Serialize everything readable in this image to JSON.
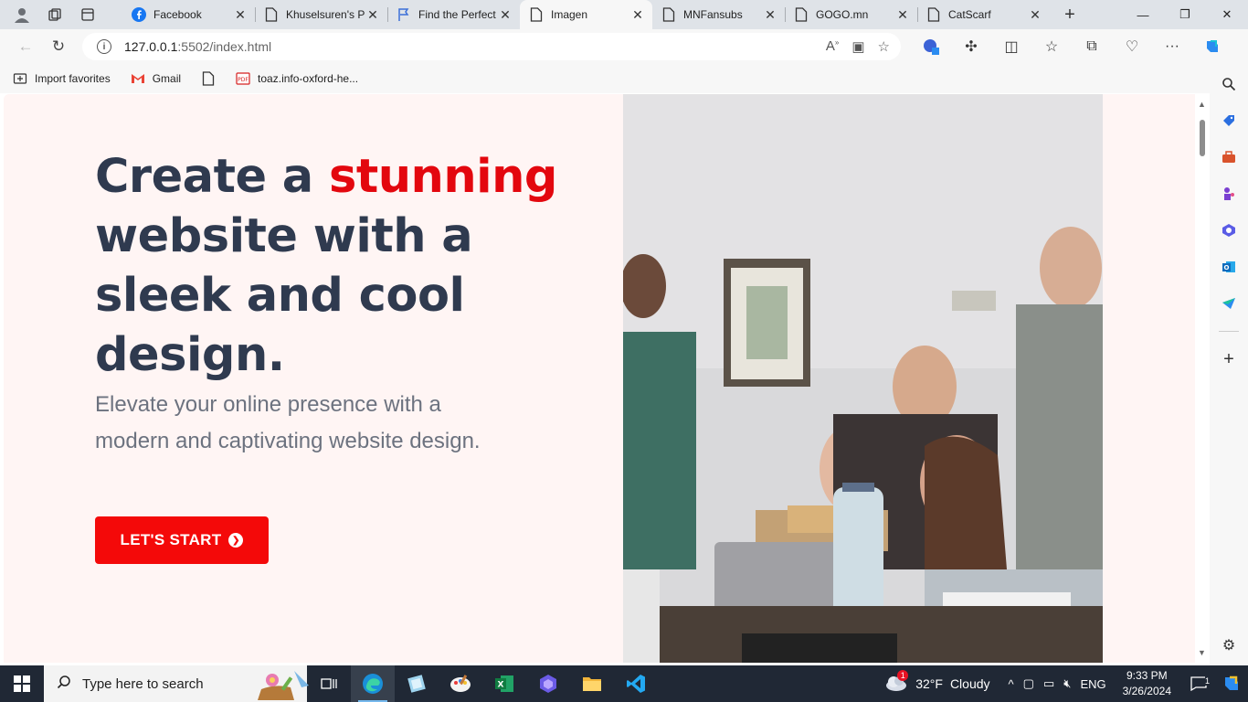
{
  "browser": {
    "tabs": [
      {
        "title": "Facebook",
        "icon": "facebook-icon",
        "active": false
      },
      {
        "title": "Khuselsuren's P",
        "icon": "page-icon",
        "active": false
      },
      {
        "title": "Find the Perfect",
        "icon": "flag-icon",
        "active": false
      },
      {
        "title": "Imagen",
        "icon": "page-icon",
        "active": true
      },
      {
        "title": "MNFansubs",
        "icon": "page-icon",
        "active": false
      },
      {
        "title": "GOGO.mn",
        "icon": "page-icon",
        "active": false
      },
      {
        "title": "CatScarf",
        "icon": "page-icon",
        "active": false
      }
    ],
    "address": {
      "host": "127.0.0.1",
      "rest": ":5502/index.html"
    },
    "favorites": [
      {
        "label": "Import favorites",
        "icon": "import-icon"
      },
      {
        "label": "Gmail",
        "icon": "gmail-icon"
      },
      {
        "label": "",
        "icon": "page-icon"
      },
      {
        "label": "toaz.info-oxford-he...",
        "icon": "pdf-icon"
      }
    ]
  },
  "hero": {
    "headline_1": "Create a ",
    "headline_accent": "stunning",
    "headline_2": "website with a sleek and cool design.",
    "subtext": "Elevate your online presence with a modern and captivating website design.",
    "cta_label": "LET'S START",
    "accent_color": "#e3070e",
    "cta_color": "#f40909",
    "background_color": "#fff5f4"
  },
  "taskbar": {
    "search_placeholder": "Type here to search",
    "weather": {
      "temp": "32°F",
      "condition": "Cloudy",
      "alert_count": "1"
    },
    "language": "ENG",
    "time": "9:33 PM",
    "date": "3/26/2024",
    "notification_count": "1"
  }
}
